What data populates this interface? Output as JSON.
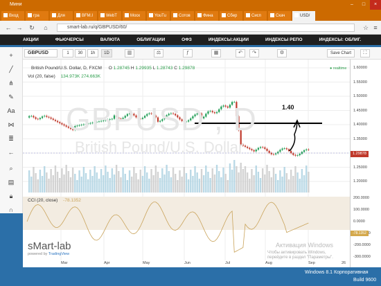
{
  "window": {
    "title": "Мини"
  },
  "tabs": [
    "Вход",
    "гра",
    "Для",
    "BFM.I",
    "WebT",
    "Моск",
    "YouTu",
    "Сотов",
    "Фина",
    "Сбер",
    "Сисп",
    "Скач",
    "USD/"
  ],
  "address": {
    "url": "smart-lab.ru/q/GBPUSD/60/",
    "back_icon": "arrow-left-icon",
    "fwd_icon": "arrow-right-icon",
    "reload_icon": "reload-icon",
    "home_icon": "home-icon"
  },
  "menu": [
    "АКЦИИ",
    "ФЬЮЧЕРСЫ",
    "ВАЛЮТА",
    "ОБЛИГАЦИИ",
    "ОФЗ",
    "ИНДЕКСЫ:АКЦИИ",
    "ИНДЕКСЫ РЕПО",
    "ИНДЕКСЫ: ОБЛИГ."
  ],
  "toolbar": {
    "symbol": "GBPUSD",
    "intervals": [
      "1",
      "30",
      "1h",
      "1D"
    ],
    "selected": "1D",
    "save": "Save Chart"
  },
  "legend": {
    "main": "British Pound/U.S. Dollar, D, FXCM",
    "o_label": "O",
    "o": "1.28745",
    "h_label": "H",
    "h": "1.29935",
    "l_label": "L",
    "l": "1.28743",
    "c_label": "C",
    "c": "1.29878",
    "vol_label": "Vol (20, false)",
    "vol1": "134.973K",
    "vol2": "274.663K",
    "cci_label": "CCI (20, close)",
    "cci": "-78.1352",
    "realtime": "realtime"
  },
  "watermark": {
    "symbol": "GBPUSD , D",
    "name": "British Pound/U.S. Dollar"
  },
  "annotation": {
    "level": "1.40"
  },
  "price_axis": [
    "1.60000",
    "1.55000",
    "1.50000",
    "1.45000",
    "1.40000",
    "1.35000",
    "1.30000",
    "1.25000",
    "1.20000"
  ],
  "current_price": "1.29878",
  "cci_axis": [
    "200.0000",
    "100.0000",
    "0.0000",
    "-100.0000",
    "-200.0000",
    "-300.0000"
  ],
  "cci_current": "-78.1352",
  "xaxis": [
    "Mar",
    "Apr",
    "May",
    "Jun",
    "Jul",
    "Aug",
    "Sep",
    "26"
  ],
  "branding": {
    "name": "sMart-lab",
    "powered": "powered by",
    "powered_link": "TradingView"
  },
  "os": {
    "activation": "Активация Windows",
    "activation_sub": "Чтобы активировать Windows, перейдите в раздел \"Параметры\".",
    "edition": "Windows 8.1 Корпоративная",
    "build": "Build 9600"
  },
  "colors": {
    "up": "#1f9d55",
    "down": "#c0392b",
    "cci": "#c9a35a",
    "menu_bg": "#1f1f1f",
    "titlebar": "#cc6a00"
  }
}
